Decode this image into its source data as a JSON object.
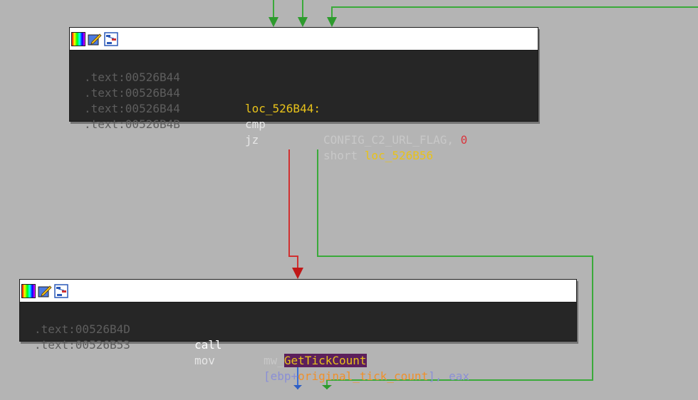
{
  "colors": {
    "background": "#b4b4b4",
    "node_body": "#262626",
    "address": "#5e5e5e",
    "label": "#e8c21a",
    "number": "#d9363e",
    "variable": "#f0902a",
    "edge_false": "#d03030",
    "edge_true": "#3aaa3a",
    "edge_flow": "#3b6fd6",
    "highlight": "#5c1f5c"
  },
  "header_icons": [
    "color-palette-icon",
    "edit-pencil-icon",
    "graph-view-icon"
  ],
  "block1": {
    "lines": [
      {
        "addr": ".text:00526B44"
      },
      {
        "addr": ".text:00526B44",
        "label": "loc_526B44:"
      },
      {
        "addr": ".text:00526B44",
        "mnemonic": "cmp",
        "op1": "CONFIG_C2_URL_FLAG, ",
        "op2": "0"
      },
      {
        "addr": ".text:00526B4B",
        "mnemonic": "jz",
        "op1": "short ",
        "op2": "loc_526B56"
      }
    ]
  },
  "block2": {
    "lines": [
      {
        "addr": ".text:00526B4D",
        "mnemonic": "call",
        "op_prefix": "mw_",
        "op_highlight": "GetTickCount"
      },
      {
        "addr": ".text:00526B53",
        "mnemonic": "mov",
        "op_open": "[ebp+",
        "op_var": "original_tick_count",
        "op_close": "], ",
        "op_reg": "eax"
      }
    ]
  }
}
